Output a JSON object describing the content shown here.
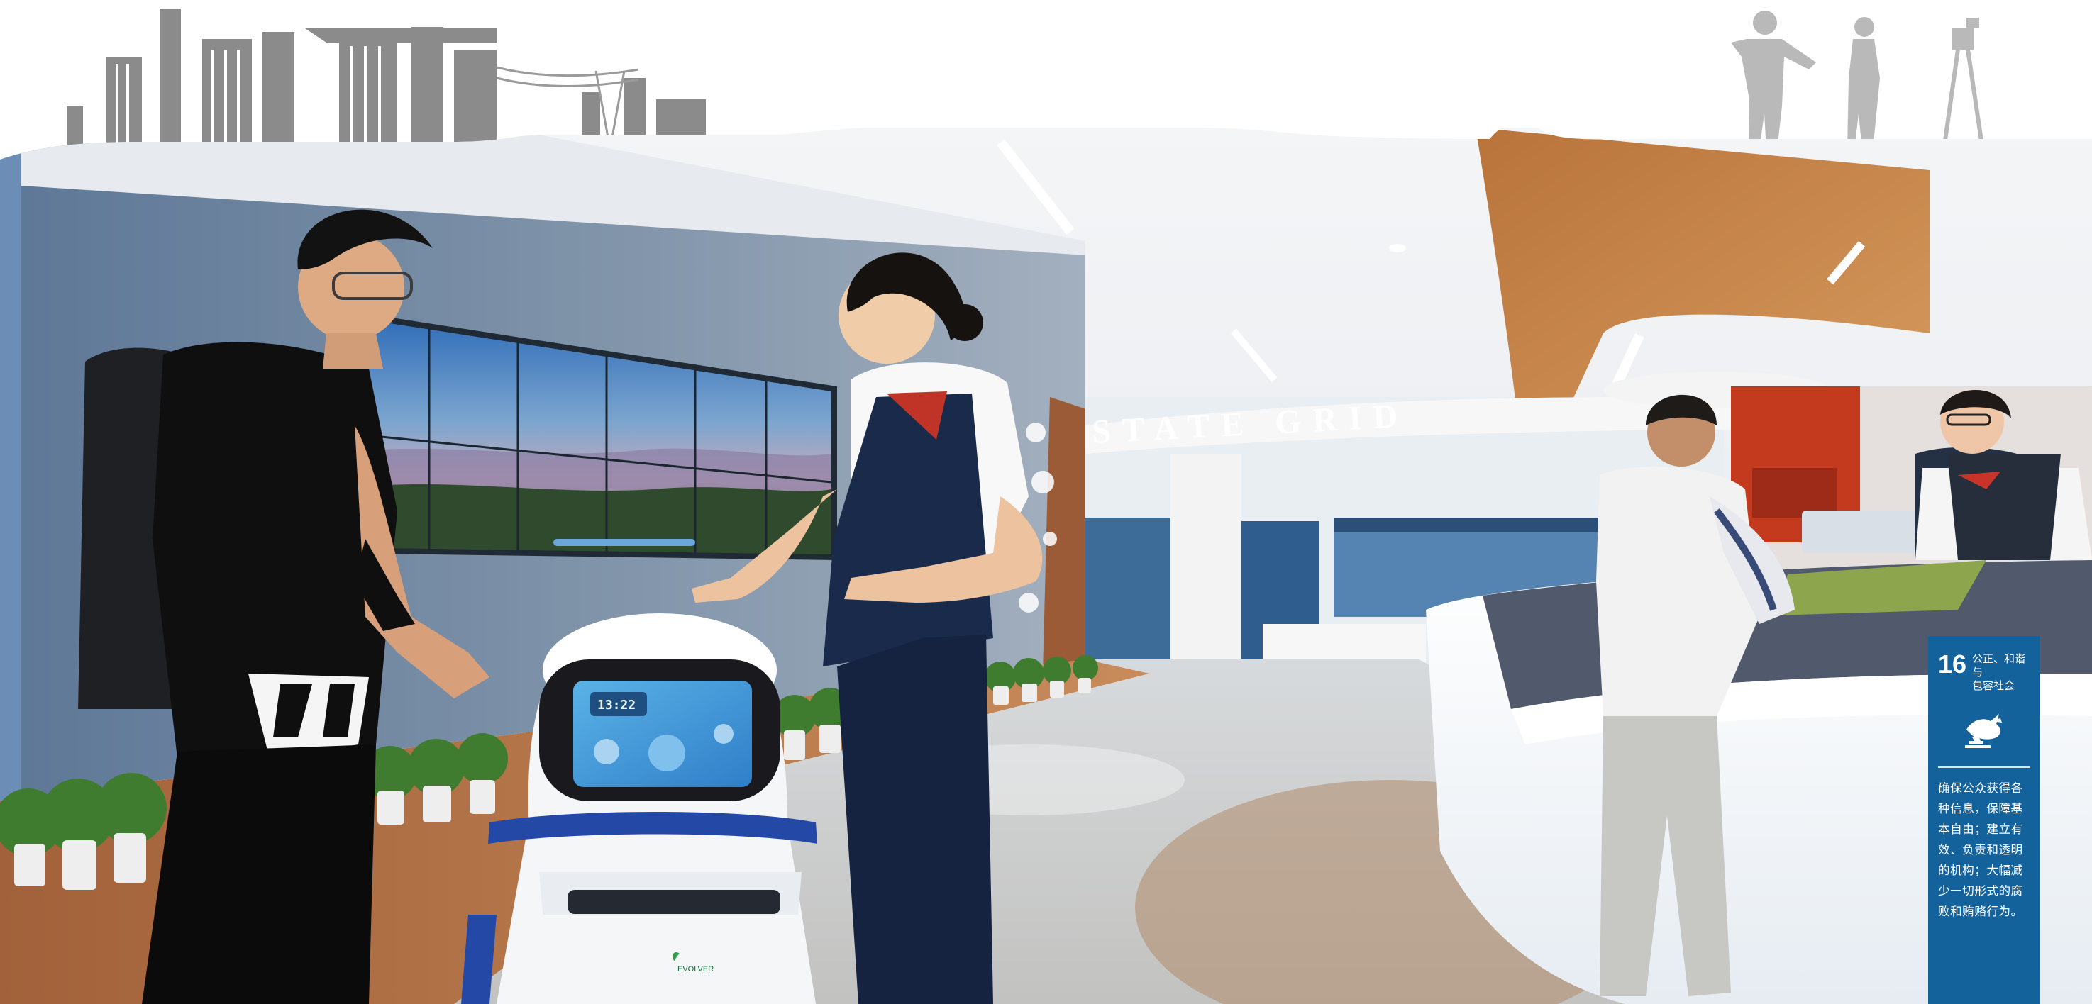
{
  "sdg_panel": {
    "goal_number": "16",
    "goal_title_line1": "公正、和谐与",
    "goal_title_line2": "包容社会",
    "icon": "dove-gavel-icon",
    "description_lines": [
      "确保公众获得各",
      "种信息，保障基",
      "本自由；建立有",
      "效、负责和透明",
      "的机构；大幅减",
      "少一切形式的腐",
      "败和贿赂行为。"
    ],
    "panel_color": "#14629b"
  },
  "robot": {
    "screen_clock": "13:22",
    "brand": "EVOLVER"
  },
  "signage": {
    "wall_logo": "STATE GRID"
  }
}
